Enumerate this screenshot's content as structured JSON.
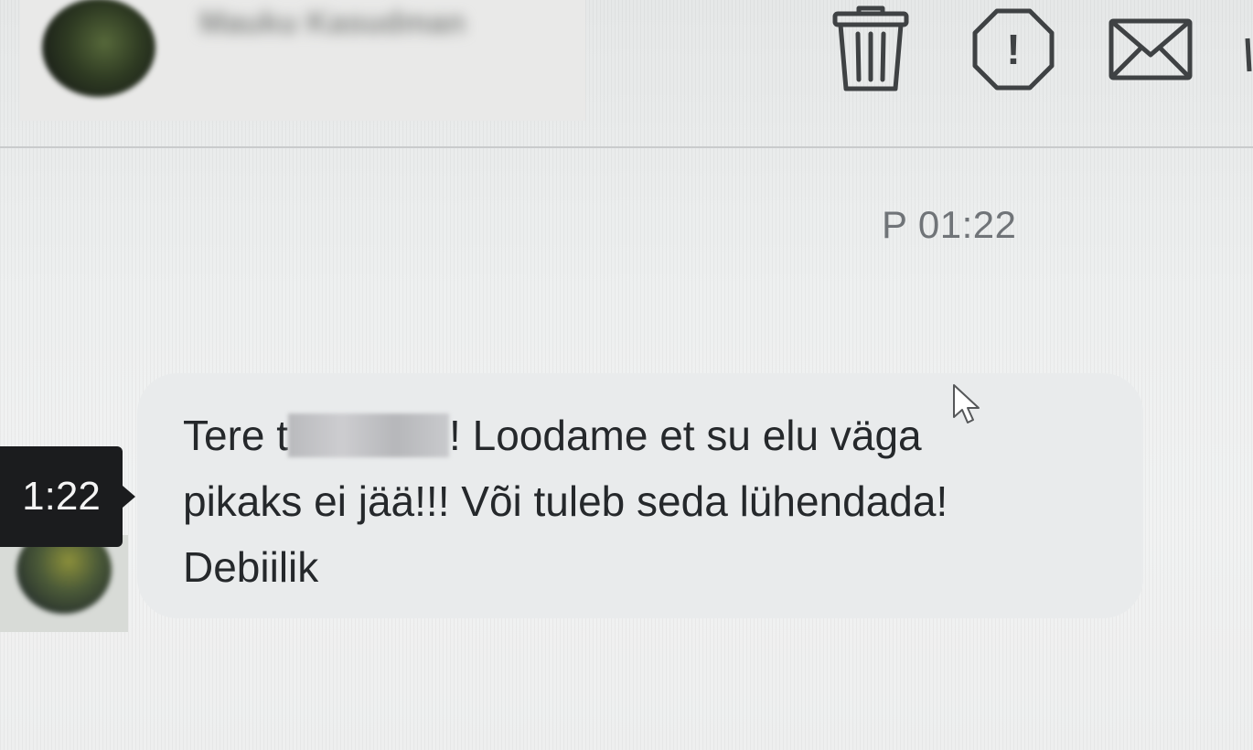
{
  "header": {
    "contact_name": "Mauku Kasudman",
    "actions": [
      {
        "name": "delete",
        "icon": "trash-icon"
      },
      {
        "name": "report",
        "icon": "alert-octagon-icon"
      },
      {
        "name": "mail",
        "icon": "envelope-icon"
      }
    ],
    "report_glyph": "!"
  },
  "conversation": {
    "timestamp": "P 01:22",
    "message": {
      "greeting_prefix": "Tere t",
      "line1_suffix": "! Loodame et su elu väga",
      "line2": "pikaks ei jää!!! Või tuleb seda lühendada!",
      "line3": "Debiilik"
    },
    "tooltip_time": "1:22"
  },
  "colors": {
    "background": "#eceeee",
    "icon_stroke": "#3f4244",
    "text": "#25282b",
    "timestamp": "#707478",
    "tooltip_bg": "#1b1c1e",
    "bubble": "#e9ebec"
  }
}
